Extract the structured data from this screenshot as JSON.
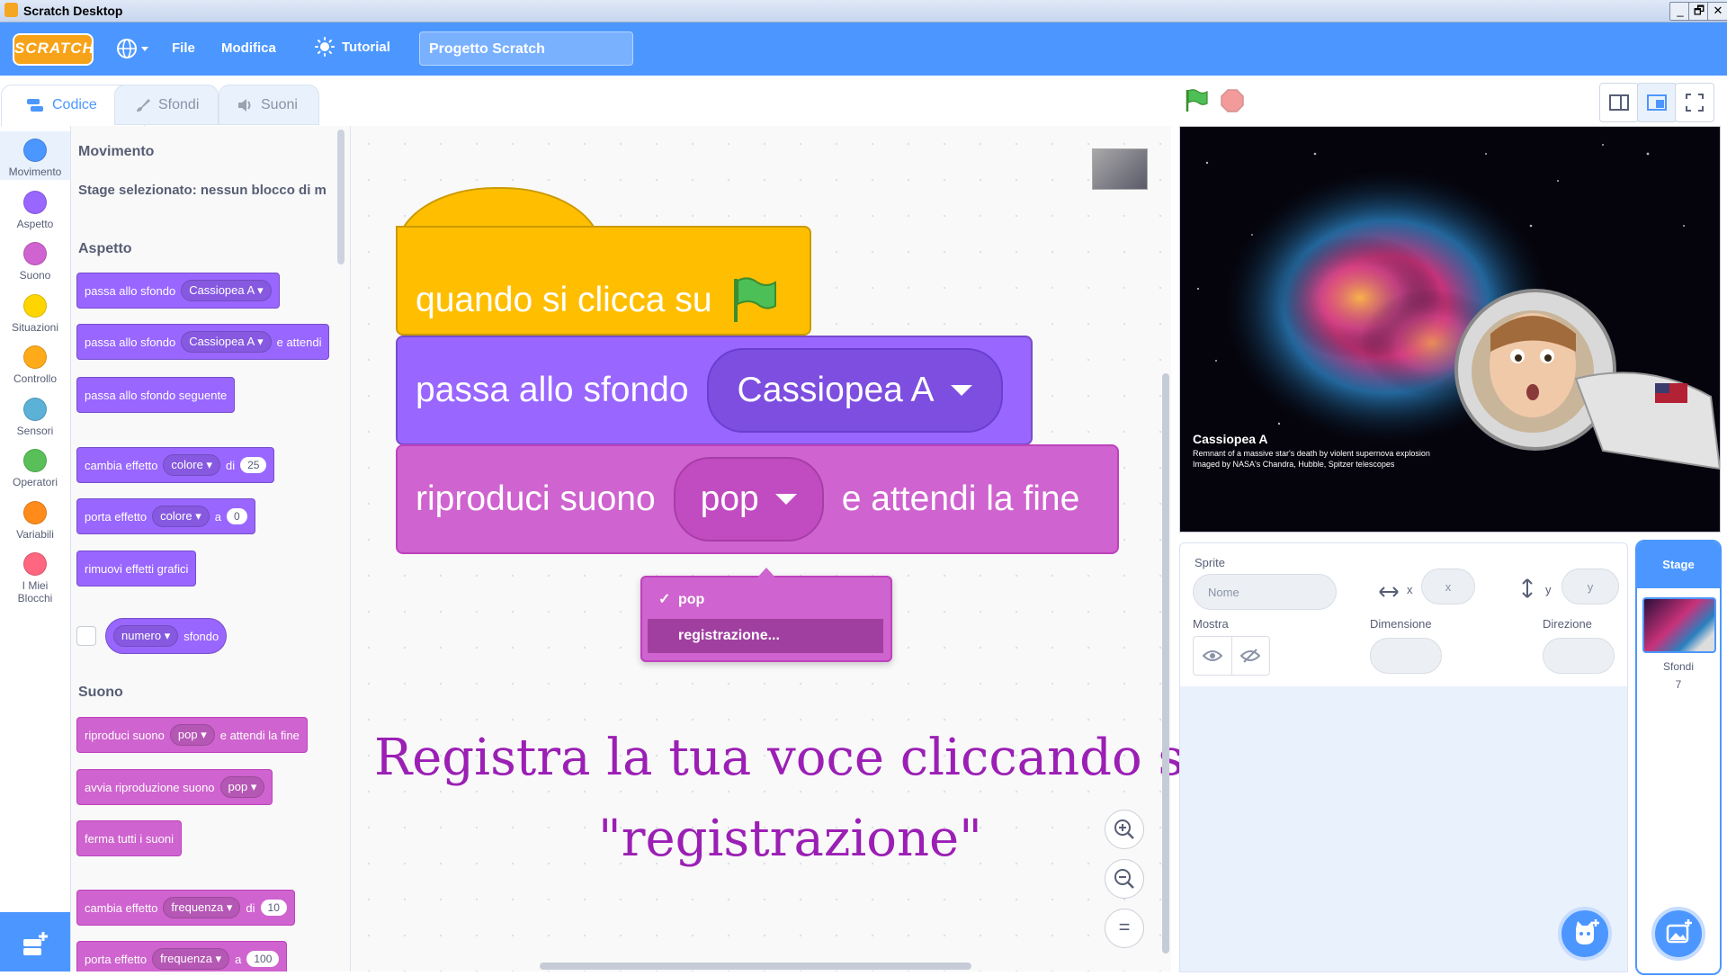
{
  "window": {
    "title": "Scratch Desktop",
    "controls": [
      "_",
      "🗗",
      "✕"
    ]
  },
  "menubar": {
    "logo_text": "SCRATCH",
    "menus": [
      "File",
      "Modifica"
    ],
    "tutorial_label": "Tutorial",
    "project_title": "Progetto Scratch"
  },
  "tabs": [
    {
      "label": "Codice",
      "active": true
    },
    {
      "label": "Sfondi",
      "active": false
    },
    {
      "label": "Suoni",
      "active": false
    }
  ],
  "categories": [
    {
      "label": "Movimento",
      "color": "#4c97ff",
      "selected": true
    },
    {
      "label": "Aspetto",
      "color": "#9966ff"
    },
    {
      "label": "Suono",
      "color": "#cf63cf"
    },
    {
      "label": "Situazioni",
      "color": "#ffd500"
    },
    {
      "label": "Controllo",
      "color": "#ffab19"
    },
    {
      "label": "Sensori",
      "color": "#5cb1d6"
    },
    {
      "label": "Operatori",
      "color": "#59c059"
    },
    {
      "label": "Variabili",
      "color": "#ff8c1a"
    },
    {
      "label": "I Miei Blocchi",
      "color": "#ff6680"
    }
  ],
  "palette": {
    "headings": {
      "movimento": "Movimento",
      "aspetto": "Aspetto",
      "suono": "Suono"
    },
    "stage_note": "Stage selezionato: nessun blocco di m",
    "looks_blocks": {
      "b1": {
        "text": "passa allo sfondo",
        "menu": "Cassiopea A"
      },
      "b2": {
        "text": "passa allo sfondo",
        "menu": "Cassiopea A",
        "suffix": "e attendi"
      },
      "b3": {
        "text": "passa allo sfondo seguente"
      },
      "b4": {
        "text": "cambia effetto",
        "menu": "colore",
        "mid": "di",
        "value": "25"
      },
      "b5": {
        "text": "porta effetto",
        "menu": "colore",
        "mid": "a",
        "value": "0"
      },
      "b6": {
        "text": "rimuovi effetti grafici"
      },
      "b7": {
        "menu": "numero",
        "suffix": "sfondo"
      }
    },
    "sound_blocks": {
      "b1": {
        "text": "riproduci suono",
        "menu": "pop",
        "suffix": "e attendi la fine"
      },
      "b2": {
        "text": "avvia riproduzione suono",
        "menu": "pop"
      },
      "b3": {
        "text": "ferma tutti i suoni"
      },
      "b4": {
        "text": "cambia effetto",
        "menu": "frequenza",
        "mid": "di",
        "value": "10"
      },
      "b5": {
        "text": "porta effetto",
        "menu": "frequenza",
        "mid": "a",
        "value": "100"
      }
    }
  },
  "script": {
    "hat_text": "quando si clicca su",
    "switch_text": "passa allo sfondo",
    "switch_menu": "Cassiopea A",
    "sound_text": "riproduci suono",
    "sound_menu": "pop",
    "sound_suffix": "e attendi la fine",
    "dropdown": {
      "items": [
        {
          "label": "pop",
          "checked": true
        },
        {
          "label": "registrazione...",
          "highlighted": true
        }
      ],
      "check": "✓"
    },
    "caption_line1": "Registra la tua voce cliccando su",
    "caption_line2": "\"registrazione\"",
    "zoom": {
      "in": "+",
      "out": "−",
      "reset": "="
    }
  },
  "stage": {
    "backdrop_title": "Cassiopea A",
    "backdrop_caption_line1": "Remnant of a massive star's death by violent supernova explosion",
    "backdrop_caption_line2": "Imaged by NASA's Chandra, Hubble, Spitzer telescopes"
  },
  "sprite_info": {
    "sprite_label": "Sprite",
    "name_placeholder": "Nome",
    "x_label": "x",
    "x_placeholder": "x",
    "y_label": "y",
    "y_placeholder": "y",
    "show_label": "Mostra",
    "size_label": "Dimensione",
    "direction_label": "Direzione"
  },
  "stage_panel": {
    "title": "Stage",
    "backdrops_label": "Sfondi",
    "backdrops_count": "7"
  },
  "colors": {
    "accent": "#4c97ff",
    "looks": "#9966ff",
    "sound": "#cf63cf",
    "events": "#ffbf00",
    "caption": "#9b1fb5"
  }
}
